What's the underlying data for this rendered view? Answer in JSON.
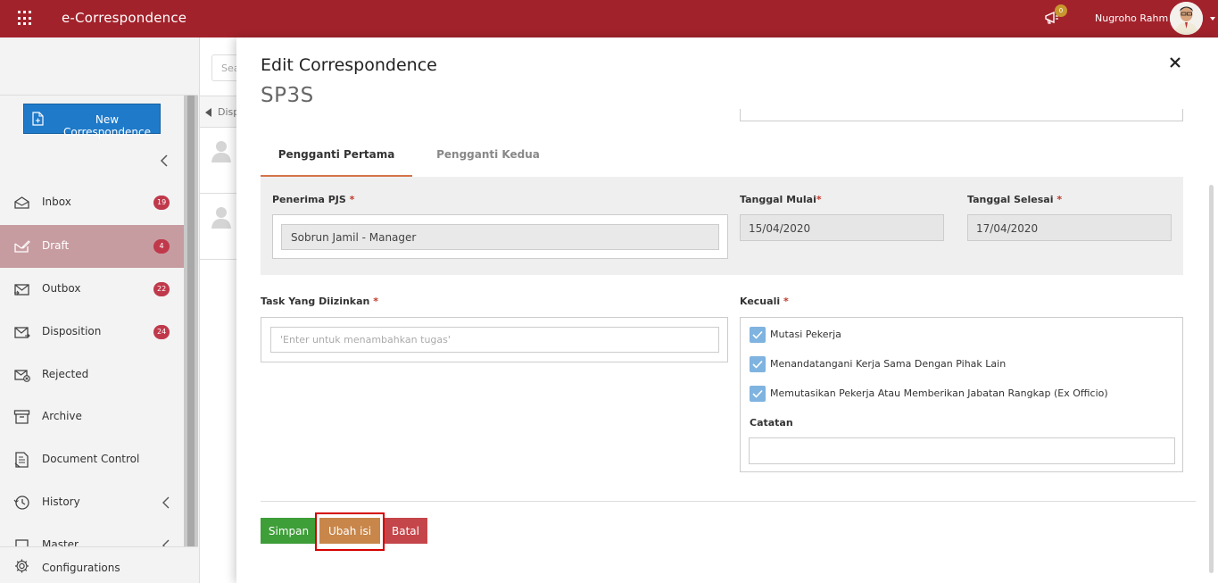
{
  "header": {
    "app_title": "e-Correspondence",
    "notification_count": "0",
    "user_name": "Nugroho Rahm"
  },
  "sidebar": {
    "new_button_label": "New Correspondence",
    "items": [
      {
        "label": "Inbox",
        "badge": "19",
        "icon": "inbox-icon"
      },
      {
        "label": "Draft",
        "badge": "4",
        "icon": "draft-icon"
      },
      {
        "label": "Outbox",
        "badge": "22",
        "icon": "outbox-icon"
      },
      {
        "label": "Disposition",
        "badge": "24",
        "icon": "disposition-icon"
      },
      {
        "label": "Rejected",
        "icon": "rejected-icon"
      },
      {
        "label": "Archive",
        "icon": "archive-icon"
      },
      {
        "label": "Document Control",
        "icon": "document-control-icon"
      },
      {
        "label": "History",
        "icon": "history-icon"
      },
      {
        "label": "Master",
        "icon": "master-icon"
      }
    ],
    "configurations_label": "Configurations"
  },
  "middle": {
    "search_placeholder": "Sea",
    "tab_label": "Disp"
  },
  "modal": {
    "title": "Edit Correspondence",
    "subtitle": "SP3S",
    "tabs": [
      "Pengganti Pertama",
      "Pengganti Kedua"
    ],
    "penerima_label": "Penerima PJS",
    "penerima_value": "Sobrun Jamil - Manager",
    "tanggal_mulai_label": "Tanggal Mulai",
    "tanggal_mulai_value": "15/04/2020",
    "tanggal_selesai_label": "Tanggal Selesai",
    "tanggal_selesai_value": "17/04/2020",
    "task_label": "Task Yang Diizinkan",
    "task_placeholder": "'Enter untuk menambahkan tugas'",
    "kecuali_label": "Kecuali",
    "kecuali_options": [
      {
        "label": "Mutasi Pekerja",
        "checked": true
      },
      {
        "label": "Menandatangani Kerja Sama Dengan Pihak Lain",
        "checked": true
      },
      {
        "label": "Memutasikan Pekerja Atau Memberikan Jabatan Rangkap (Ex Officio)",
        "checked": true
      }
    ],
    "catatan_label": "Catatan",
    "buttons": {
      "save": "Simpan",
      "edit": "Ubah isi",
      "cancel": "Batal"
    }
  },
  "colors": {
    "brand": "#a2222b",
    "primary": "#1f7ac9",
    "save": "#3e9e38",
    "edit": "#c8864a",
    "cancel": "#c4464a",
    "active_tab_underline": "#d4744a",
    "highlight": "#d40000"
  }
}
